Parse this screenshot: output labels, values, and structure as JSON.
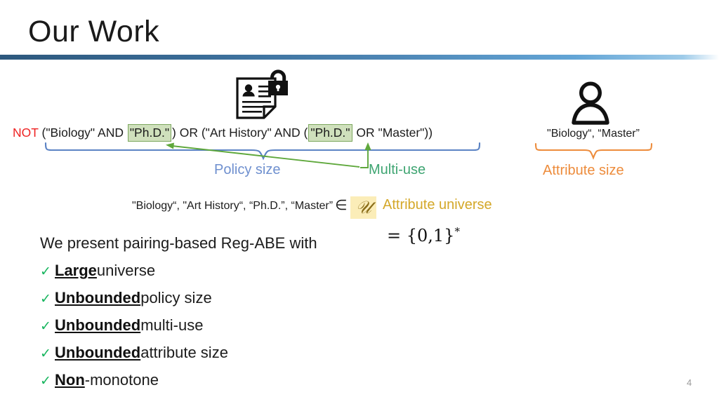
{
  "slide": {
    "title": "Our Work",
    "page_number": "4",
    "accent_rule_from": "#2d587d",
    "accent_rule_to": "#63a5d6"
  },
  "policy": {
    "not_keyword": "NOT",
    "segment_1": " (\"Biology\" AND ",
    "highlight_1": "\"Ph.D.\"",
    "segment_2": ") OR (\"Art History\" AND (",
    "highlight_2": "\"Ph.D.\"",
    "segment_3": " OR \"Master\"))",
    "full_text": "NOT (\"Biology\" AND \"Ph.D.\") OR (\"Art History\" AND (\"Ph.D.\" OR \"Master\"))",
    "not_color": "#ee2222",
    "highlight_fill": "#cfe0bc",
    "highlight_border": "#7da85f"
  },
  "annotations": {
    "policy_size_label": "Policy size",
    "policy_size_color": "#6f90cf",
    "multi_use_label": "Multi-use",
    "multi_use_color": "#3fa572",
    "attribute_size_label": "Attribute size",
    "attribute_size_color": "#ed8c3c"
  },
  "attributes": {
    "user_attributes": "\"Biology“, “Master”"
  },
  "universe": {
    "attribute_list": "\"Biology“, \"Art History“, “Ph.D.”, “Master”",
    "member_symbol": "∈",
    "universe_symbol": "𝒰",
    "universe_label": "Attribute universe",
    "universe_highlight": "#fbedb8",
    "universe_label_color": "#d4a829",
    "equals_binary": "= {0,1}",
    "equals_binary_sup": "*"
  },
  "body": {
    "intro": "We present pairing-based Reg-ABE with",
    "bullets": [
      {
        "check": "✓",
        "strong": "Large",
        "rest": " universe"
      },
      {
        "check": "✓",
        "strong": "Unbounded",
        "rest": " policy size"
      },
      {
        "check": "✓",
        "strong": "Unbounded",
        "rest": " multi-use"
      },
      {
        "check": "✓",
        "strong": "Unbounded",
        "rest": " attribute size"
      },
      {
        "check": "✓",
        "strong": "Non",
        "rest": "-monotone"
      }
    ]
  },
  "icons": {
    "document_lock": "encrypted-document-icon",
    "person": "user-icon"
  }
}
